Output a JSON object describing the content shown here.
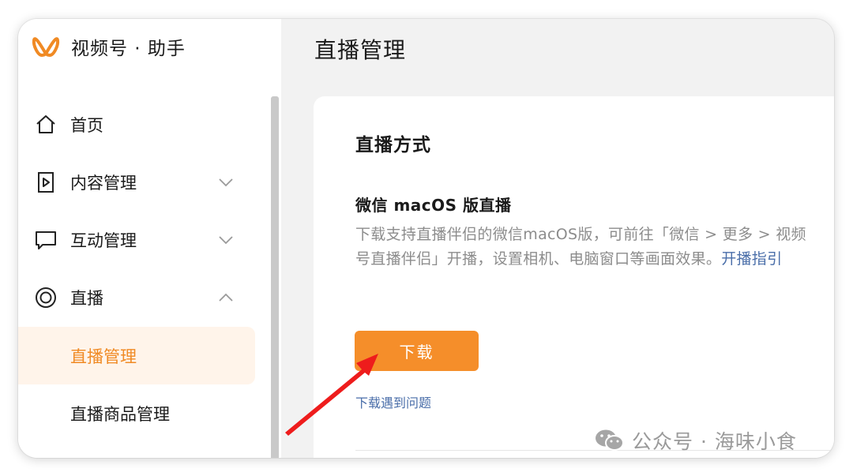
{
  "app": {
    "name": "视频号 · 助手"
  },
  "sidebar": {
    "items": [
      {
        "label": "首页",
        "icon": "home-icon"
      },
      {
        "label": "内容管理",
        "icon": "play-box-icon"
      },
      {
        "label": "互动管理",
        "icon": "comment-icon"
      },
      {
        "label": "直播",
        "icon": "live-icon"
      }
    ],
    "sub_items": [
      {
        "label": "直播管理",
        "active": true
      },
      {
        "label": "直播商品管理",
        "active": false
      }
    ]
  },
  "main": {
    "title": "直播管理",
    "card": {
      "section_title": "直播方式",
      "method_title": "微信 macOS 版直播",
      "method_desc": "下载支持直播伴侣的微信macOS版，可前往「微信 > 更多 > 视频号直播伴侣」开播，设置相机、电脑窗口等画面效果。",
      "guide_link": "开播指引",
      "download_label": "下载",
      "help_link": "下载遇到问题"
    }
  },
  "watermark": {
    "text": "公众号 · 海味小食"
  },
  "colors": {
    "accent": "#f58e2a",
    "active_bg": "#fff4ea",
    "link": "#4a6ea9",
    "annotation_arrow": "#ee1c1c"
  }
}
